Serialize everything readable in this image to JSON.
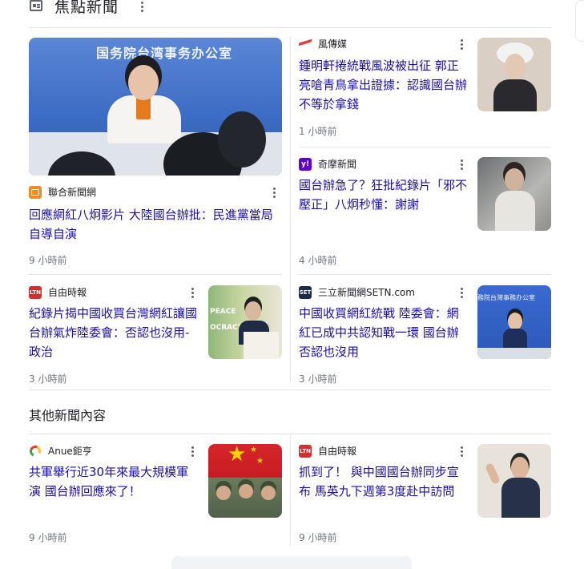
{
  "header": {
    "title": "焦點新聞",
    "icon": "news-icon"
  },
  "top_stories": [
    {
      "source": "聯合新聞網",
      "headline": "回應網紅八炯影片 大陸國台辦批：民進黨當局自導自演",
      "time": "9 小時前",
      "image_banner_text": "国务院台湾事务办公室",
      "logo_color": "#f08c1e"
    },
    {
      "source": "風傳媒",
      "headline": "鍾明軒捲統戰風波被出征 郭正亮嗆青鳥拿出證據：認識國台辦不等於拿錢",
      "time": "1 小時前",
      "logo_color": "#e53935"
    },
    {
      "source": "奇摩新聞",
      "headline": "國台辦急了？狂批紀錄片「邪不壓正」八炯秒懂：謝謝",
      "time": "4 小時前",
      "logo_text": "y!",
      "logo_color": "#6001d2"
    },
    {
      "source": "自由時報",
      "headline": "紀錄片揭中國收買台灣網紅讓國台辦氣炸陸委會：否認也沒用- 政治",
      "time": "3 小時前",
      "logo_text": "LTN",
      "logo_color": "#d32f2f",
      "image_text": [
        "PEACE",
        "OCRACY"
      ]
    },
    {
      "source": "三立新聞網SETN.com",
      "headline": "中國收買網紅統戰 陸委會：網紅已成中共認知戰一環 國台辦否認也沒用",
      "time": "3 小時前",
      "logo_text": "SET",
      "logo_color": "#1c2b4a",
      "image_text": "務院台灣事務办公室"
    }
  ],
  "more": {
    "title": "其他新聞內容",
    "items": [
      {
        "source": "Anue鉅亨",
        "headline": "共軍舉行近30年來最大規模軍演 國台辦回應來了！",
        "time": "9 小時前",
        "logo_color": "#2e7d32"
      },
      {
        "source": "自由時報",
        "headline": "抓到了！ 與中國國台辦同步宣布 馬英九下週第3度赴中訪問",
        "time": "9 小時前",
        "logo_text": "LTN",
        "logo_color": "#d32f2f"
      }
    ]
  }
}
